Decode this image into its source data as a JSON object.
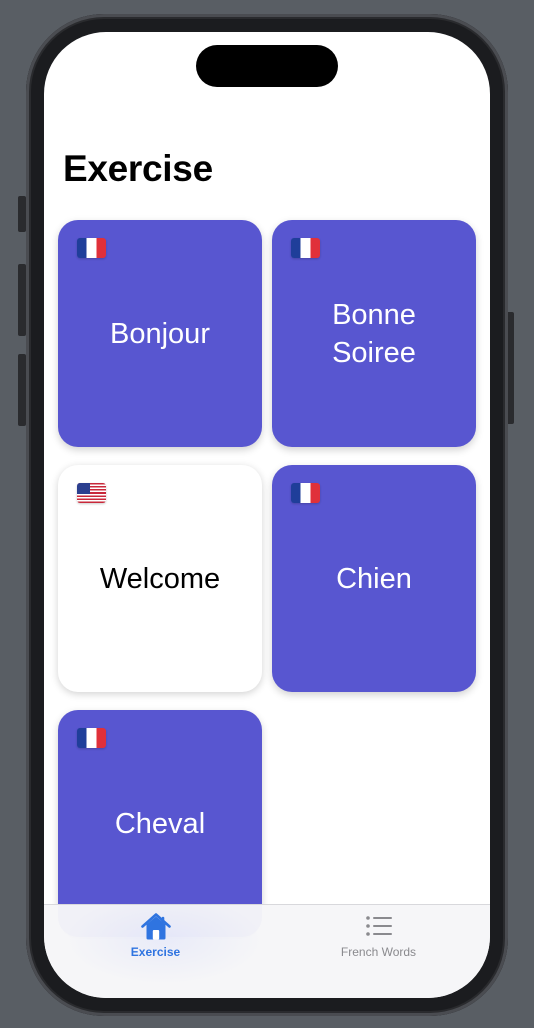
{
  "page": {
    "title": "Exercise"
  },
  "cards": [
    {
      "flag": "france-flag-icon",
      "word": "Bonjour",
      "style": "filled"
    },
    {
      "flag": "france-flag-icon",
      "word": "Bonne Soiree",
      "style": "filled"
    },
    {
      "flag": "usa-flag-icon",
      "word": "Welcome",
      "style": "light"
    },
    {
      "flag": "france-flag-icon",
      "word": "Chien",
      "style": "filled"
    },
    {
      "flag": "france-flag-icon",
      "word": "Cheval",
      "style": "filled"
    }
  ],
  "tabbar": {
    "tabs": [
      {
        "label": "Exercise",
        "icon": "house-icon",
        "selected": true
      },
      {
        "label": "French Words",
        "icon": "list-icon",
        "selected": false
      }
    ]
  },
  "colors": {
    "card_fill": "#5856d0",
    "accent": "#2f74e0",
    "inactive_tab": "#8a8a8e"
  }
}
